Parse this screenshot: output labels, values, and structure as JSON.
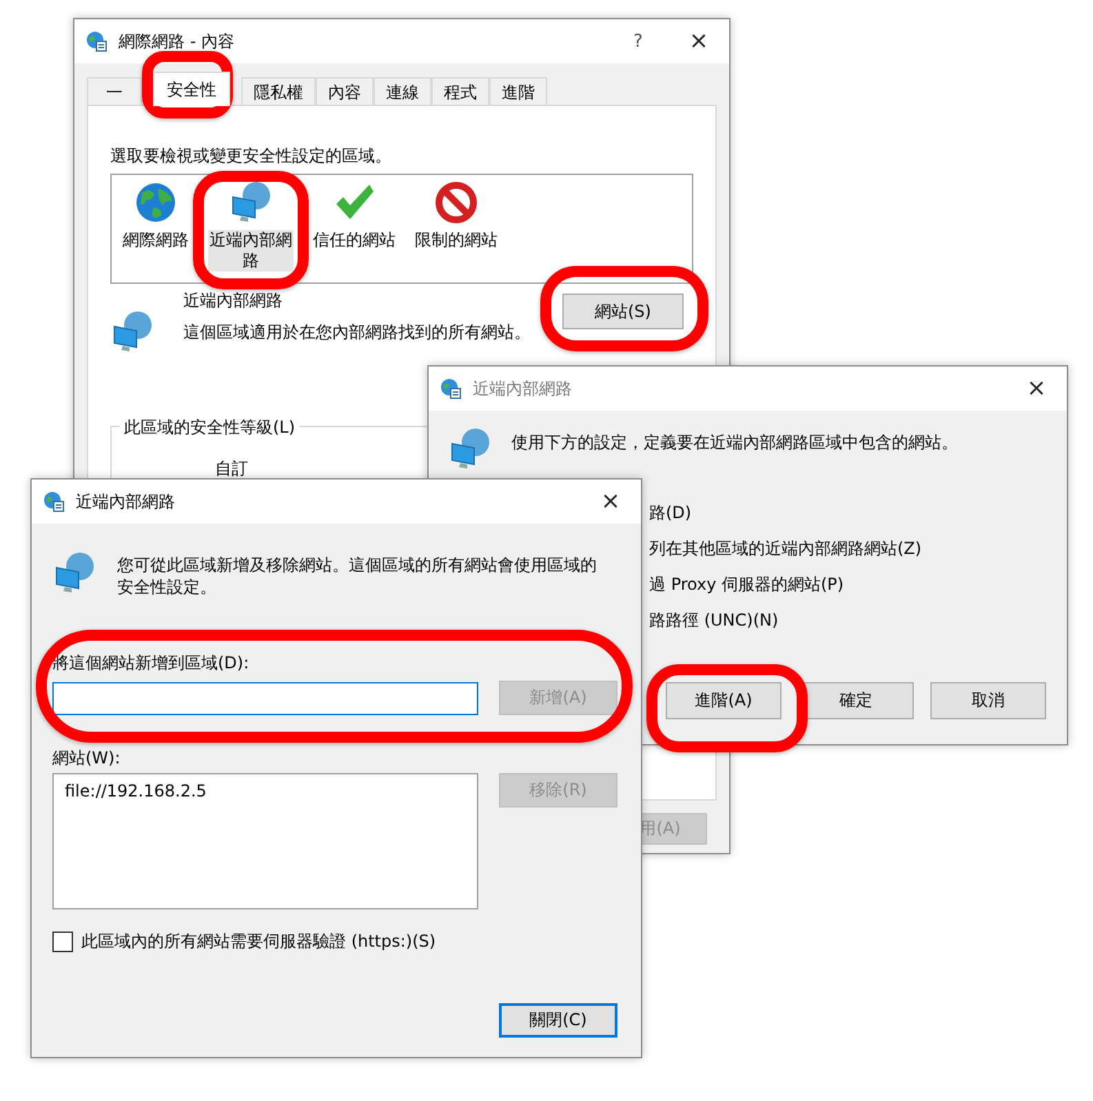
{
  "properties_window": {
    "title": "網際網路 - 內容",
    "help": "?",
    "close": "×",
    "tabs": [
      {
        "label": "一",
        "selected": false
      },
      {
        "label": "安全性",
        "selected": true
      },
      {
        "label": "隱私權",
        "selected": false
      },
      {
        "label": "內容",
        "selected": false
      },
      {
        "label": "連線",
        "selected": false
      },
      {
        "label": "程式",
        "selected": false
      },
      {
        "label": "進階",
        "selected": false
      }
    ],
    "zone_prompt": "選取要檢視或變更安全性設定的區域。",
    "zones": [
      {
        "kind": "internet",
        "label": "網際網路",
        "selected": false
      },
      {
        "kind": "intranet",
        "label": "近端內部網路",
        "selected": true
      },
      {
        "kind": "trusted",
        "label": "信任的網站",
        "selected": false
      },
      {
        "kind": "restricted",
        "label": "限制的網站",
        "selected": false
      }
    ],
    "zone_title": "近端內部網路",
    "zone_description": "這個區域適用於在您內部網路找到的所有網站。",
    "sites_button": "網站(S)",
    "level_group": "此區域的安全性等級(L)",
    "level_name": "自訂",
    "apply_button": {
      "label": "用(A)",
      "disabled": true
    }
  },
  "intranet_window": {
    "title": "近端內部網路",
    "close": "×",
    "description": "使用下方的設定，定義要在近端內部網路區域中包含的網站。",
    "options": [
      "路(D)",
      "列在其他區域的近端內部網路網站(Z)",
      "過 Proxy 伺服器的網站(P)",
      "路路徑 (UNC)(N)"
    ],
    "buttons": [
      "進階(A)",
      "確定",
      "取消"
    ]
  },
  "sites_window": {
    "title": "近端內部網路",
    "close": "×",
    "description": "您可從此區域新增及移除網站。這個區域的所有網站會使用區域的安全性設定。",
    "add_label": "將這個網站新增到區域(D):",
    "add_button": {
      "label": "新增(A)",
      "disabled": true
    },
    "list_label": "網站(W):",
    "sites": [
      "file://192.168.2.5"
    ],
    "remove_button": {
      "label": "移除(R)",
      "disabled": true
    },
    "https_checkbox": {
      "label": "此區域內的所有網站需要伺服器驗證 (https:)(S)",
      "checked": false
    },
    "close_button": "關閉(C)"
  }
}
